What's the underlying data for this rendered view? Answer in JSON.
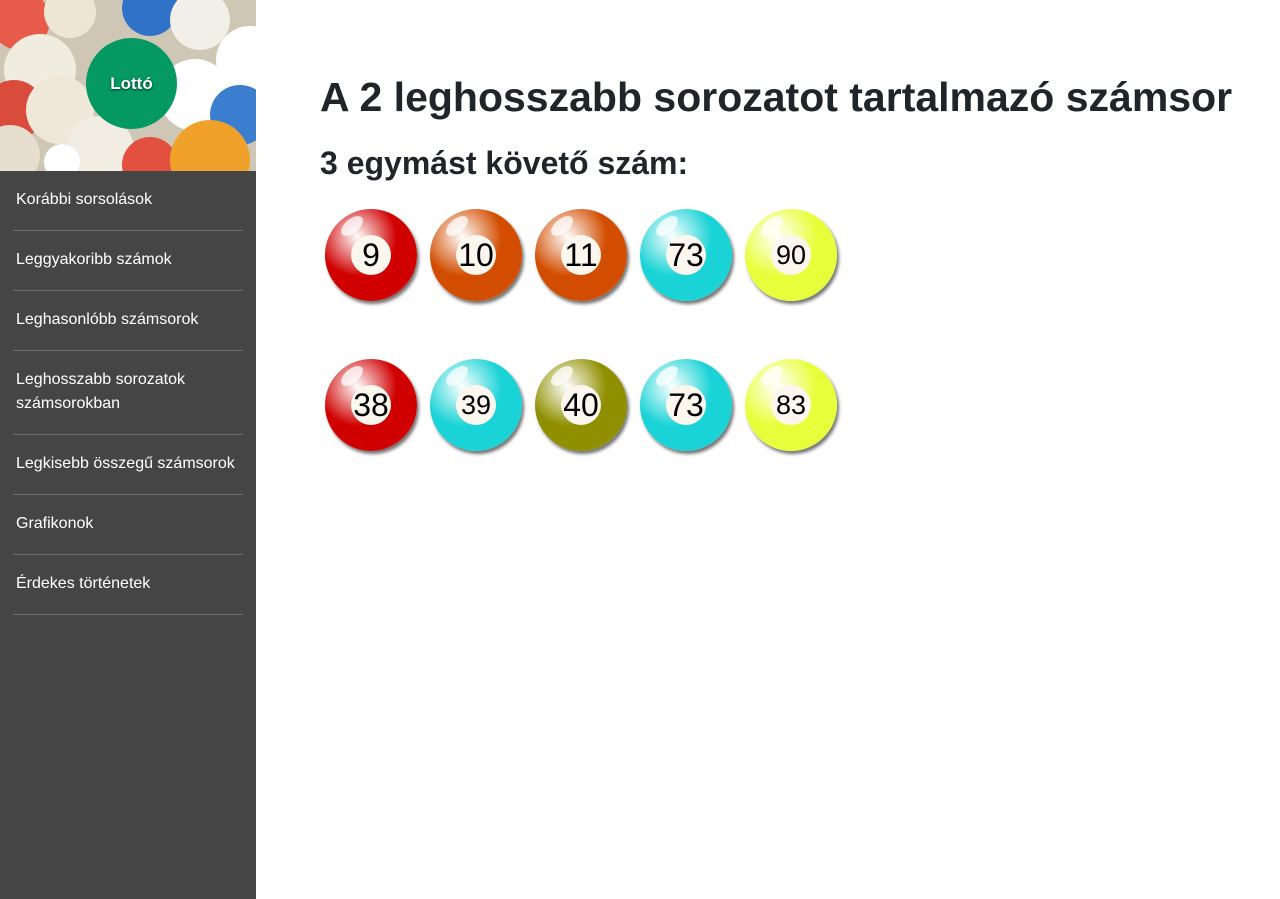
{
  "logo": {
    "label": "Lottó"
  },
  "sidebar": {
    "items": [
      {
        "label": "Korábbi sorsolások"
      },
      {
        "label": "Leggyakoribb számok"
      },
      {
        "label": "Leghasonlóbb számsorok"
      },
      {
        "label": "Leghosszabb sorozatok számsorokban"
      },
      {
        "label": "Legkisebb összegű számsorok"
      },
      {
        "label": "Grafikonok"
      },
      {
        "label": "Érdekes történetek"
      }
    ]
  },
  "main": {
    "title": "A 2 leghosszabb sorozatot tartalmazó számsor",
    "subtitle": "3 egymást követő szám:",
    "rows": [
      {
        "balls": [
          {
            "number": "9",
            "color": "#d00000"
          },
          {
            "number": "10",
            "color": "#d24d00"
          },
          {
            "number": "11",
            "color": "#d24d00"
          },
          {
            "number": "73",
            "color": "#1ad3d6"
          },
          {
            "number": "90",
            "color": "#e7ff3a"
          }
        ]
      },
      {
        "balls": [
          {
            "number": "38",
            "color": "#d00000"
          },
          {
            "number": "39",
            "color": "#1ad3d6"
          },
          {
            "number": "40",
            "color": "#8f8f00"
          },
          {
            "number": "73",
            "color": "#1ad3d6"
          },
          {
            "number": "83",
            "color": "#e7ff3a"
          }
        ]
      }
    ]
  },
  "colors": {
    "sidebar_bg": "#454545",
    "logo_green": "#049863",
    "divider": "#6c6c6c",
    "heading": "#212529"
  }
}
